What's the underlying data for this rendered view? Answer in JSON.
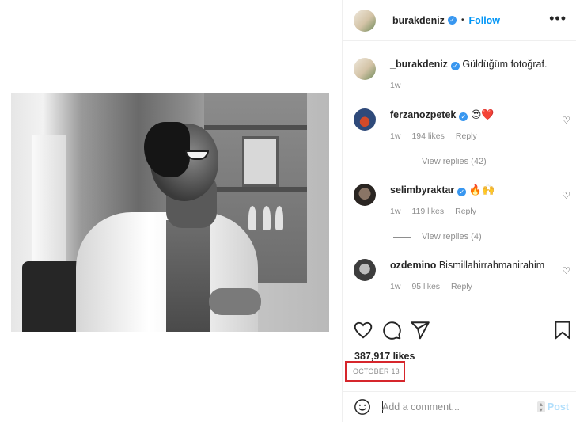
{
  "post": {
    "author": "_burakdeniz",
    "follow_label": "Follow",
    "more_label": "•••",
    "caption": "Güldüğüm fotoğraf.",
    "caption_time": "1w",
    "likes": "387,917 likes",
    "date": "OCTOBER 13"
  },
  "comments": [
    {
      "user": "ferzanozpetek",
      "verified": true,
      "text": "😍❤️",
      "time": "1w",
      "likes": "194 likes",
      "reply": "Reply",
      "view_replies": "View replies (42)"
    },
    {
      "user": "selimbyraktar",
      "verified": true,
      "text": "🔥🙌",
      "time": "1w",
      "likes": "119 likes",
      "reply": "Reply",
      "view_replies": "View replies (4)"
    },
    {
      "user": "ozdemino",
      "verified": false,
      "text": "Bismillahirrahmanirahim",
      "time": "1w",
      "likes": "95 likes",
      "reply": "Reply"
    }
  ],
  "add_comment": {
    "placeholder": "Add a comment...",
    "post_label": "Post"
  },
  "icons": {
    "like": "heart-icon",
    "comment": "comment-icon",
    "share": "paper-plane-icon",
    "save": "bookmark-icon",
    "emoji": "smiley-icon",
    "verified": "verified-badge-icon",
    "more": "more-options-icon"
  },
  "colors": {
    "link": "#0095f6",
    "verified": "#3897f0",
    "muted": "#8e8e8e",
    "highlight": "#d6262c"
  }
}
